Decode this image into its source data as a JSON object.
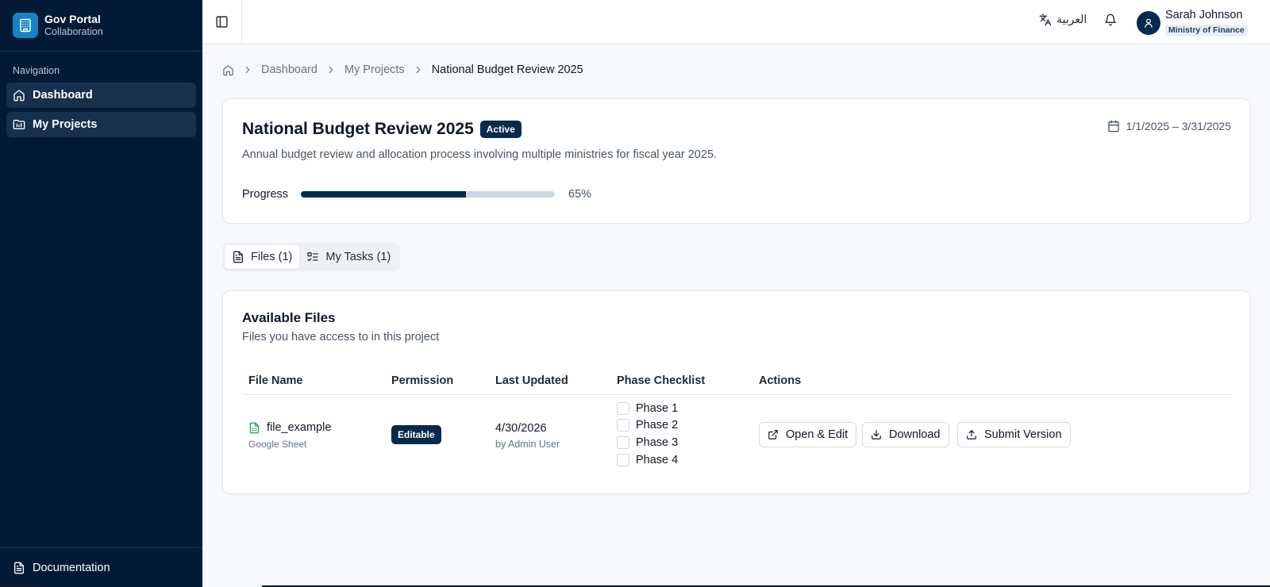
{
  "brand": {
    "title": "Gov Portal",
    "subtitle": "Collaboration"
  },
  "sidebar": {
    "heading": "Navigation",
    "items": [
      {
        "label": "Dashboard",
        "icon": "home-icon"
      },
      {
        "label": "My Projects",
        "icon": "folder-icon"
      }
    ],
    "footer": {
      "label": "Documentation",
      "icon": "document-icon"
    }
  },
  "header": {
    "language_label": "العربية",
    "user": {
      "name": "Sarah Johnson",
      "org": "Ministry of Finance"
    }
  },
  "breadcrumb": [
    "Dashboard",
    "My Projects",
    "National Budget Review 2025"
  ],
  "project": {
    "title": "National Budget Review 2025",
    "status": "Active",
    "date_range": "1/1/2025 – 3/31/2025",
    "description": "Annual budget review and allocation process involving multiple ministries for fiscal year 2025.",
    "progress_label": "Progress",
    "progress_value": 65,
    "progress_text": "65%"
  },
  "tabs": [
    {
      "label": "Files (1)",
      "active": true
    },
    {
      "label": "My Tasks (1)",
      "active": false
    }
  ],
  "files": {
    "title": "Available Files",
    "subtitle": "Files you have access to in this project",
    "columns": [
      "File Name",
      "Permission",
      "Last Updated",
      "Phase Checklist",
      "Actions"
    ],
    "rows": [
      {
        "name": "file_example",
        "type": "Google Sheet",
        "permission": "Editable",
        "updated_date": "4/30/2026",
        "updated_by": "by Admin User",
        "phases": [
          "Phase 1",
          "Phase 2",
          "Phase 3",
          "Phase 4"
        ],
        "actions": [
          "Open & Edit",
          "Download",
          "Submit Version"
        ]
      }
    ]
  },
  "colors": {
    "sidebar_bg": "#021a35",
    "primary": "#052a4d",
    "brand_logo": "#1782c4",
    "sheet_icon": "#16a34a"
  }
}
